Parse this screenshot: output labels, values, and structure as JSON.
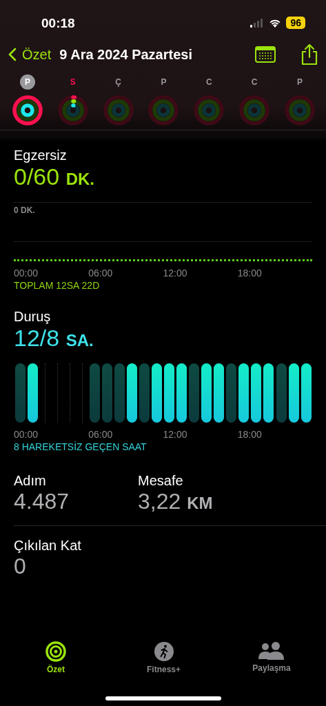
{
  "status_bar": {
    "time": "00:18",
    "battery": "96"
  },
  "nav": {
    "back": "Özet",
    "title": "9 Ara 2024 Pazartesi"
  },
  "week": [
    {
      "letter": "P",
      "selected": true,
      "today": false,
      "kind": "closed"
    },
    {
      "letter": "S",
      "selected": false,
      "today": true,
      "kind": "started"
    },
    {
      "letter": "Ç",
      "selected": false,
      "today": false,
      "kind": "empty"
    },
    {
      "letter": "P",
      "selected": false,
      "today": false,
      "kind": "empty"
    },
    {
      "letter": "C",
      "selected": false,
      "today": false,
      "kind": "empty"
    },
    {
      "letter": "C",
      "selected": false,
      "today": false,
      "kind": "empty"
    },
    {
      "letter": "P",
      "selected": false,
      "today": false,
      "kind": "empty"
    }
  ],
  "exercise": {
    "title": "Egzersiz",
    "value": "0/60",
    "unit": "DK.",
    "scale_label": "0 DK.",
    "axis": [
      "00:00",
      "06:00",
      "12:00",
      "18:00"
    ],
    "summary": "TOPLAM 12SA 22D"
  },
  "stand": {
    "title": "Duruş",
    "value": "12/8",
    "unit": "SA.",
    "hours": [
      {
        "kind": "missed"
      },
      {
        "kind": "stood"
      },
      {
        "kind": "none"
      },
      {
        "kind": "none"
      },
      {
        "kind": "none"
      },
      {
        "kind": "none"
      },
      {
        "kind": "missed"
      },
      {
        "kind": "missed"
      },
      {
        "kind": "missed"
      },
      {
        "kind": "stood"
      },
      {
        "kind": "missed"
      },
      {
        "kind": "stood"
      },
      {
        "kind": "stood"
      },
      {
        "kind": "stood"
      },
      {
        "kind": "missed"
      },
      {
        "kind": "stood"
      },
      {
        "kind": "stood"
      },
      {
        "kind": "missed"
      },
      {
        "kind": "stood"
      },
      {
        "kind": "stood"
      },
      {
        "kind": "stood"
      },
      {
        "kind": "missed"
      },
      {
        "kind": "stood"
      },
      {
        "kind": "stood"
      }
    ],
    "axis": [
      "00:00",
      "06:00",
      "12:00",
      "18:00"
    ],
    "summary": "8 HAREKETSİZ GEÇEN SAAT"
  },
  "stats": [
    {
      "label": "Adım",
      "value": "4.487"
    },
    {
      "label": "Mesafe",
      "value": "3,22",
      "unit": "KM"
    }
  ],
  "floors": {
    "label": "Çıkılan Kat",
    "value": "0"
  },
  "tab_bar": [
    {
      "label": "Özet",
      "kind": "rings",
      "selected": true
    },
    {
      "label": "Fitness+",
      "kind": "fitness",
      "selected": false
    },
    {
      "label": "Paylaşma",
      "kind": "sharing",
      "selected": false
    }
  ]
}
